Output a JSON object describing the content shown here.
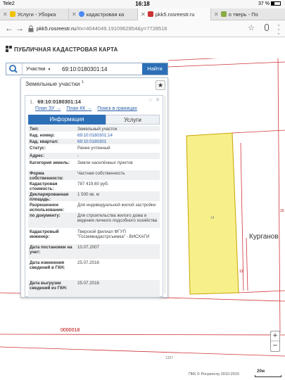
{
  "status_bar": {
    "carrier": "Tele2",
    "time": "16:18",
    "battery": "37 %"
  },
  "browser": {
    "tabs": [
      {
        "title": "Услуги - Уборка",
        "active": false
      },
      {
        "title": "кадастровая ка",
        "active": false
      },
      {
        "title": "pkk5.rosreestr.ru",
        "active": true
      },
      {
        "title": "о тверь - По",
        "active": false
      }
    ],
    "url_host": "pkk5.rosreestr.ru",
    "url_rest": "/#x=4044049.1910962854&y=7728516"
  },
  "page": {
    "title": "ПУБЛИЧНАЯ КАДАСТРОВАЯ КАРТА"
  },
  "search": {
    "type_label": "Участки",
    "query": "69:10:0180301:14",
    "button_label": "Найти"
  },
  "panel": {
    "title": "Земельные участки",
    "title_sup": "1",
    "card": {
      "index": "1.",
      "number": "69:10:0180301:14",
      "links": [
        "План ЗУ →",
        "План КК →",
        "Поиск в границах"
      ],
      "tabs": {
        "info": "Информация",
        "services": "Услуги"
      },
      "rows": [
        {
          "k": "Тип:",
          "v": "Земельный участок",
          "link": false
        },
        {
          "k": "Кад. номер:",
          "v": "69:10:0180301:14",
          "link": true
        },
        {
          "k": "Кад. квартал:",
          "v": "69:10:0180301",
          "link": true
        },
        {
          "k": "Статус:",
          "v": "Ранее учтенный",
          "link": false
        },
        {
          "k": "Адрес:",
          "v": "-",
          "link": false
        },
        {
          "k": "Категория земель:",
          "v": "Земли населённых пунктов",
          "link": false
        },
        {
          "k": "Форма собственности:",
          "v": "Частная собственность",
          "link": false
        },
        {
          "k": "Кадастровая стоимость:",
          "v": "787 419,60 руб.",
          "link": false
        },
        {
          "k": "Декларированная площадь:",
          "v": "1 500 кв. м",
          "link": false
        },
        {
          "k": "Разрешенное использование:",
          "v": "Для индивидуальной жилой застройки",
          "link": false
        },
        {
          "k": "по документу:",
          "v": "Для строительства жилого дома и ведения личного подсобного хозяйства",
          "link": false
        },
        {
          "k": "Кадастровый инженер:",
          "v": "Тверской филиал ФГУП \"Госземкадастрсъемка\" - ВИСХАГИ",
          "link": false
        },
        {
          "k": "Дата постановки на учет:",
          "v": "10.07.2007",
          "link": false
        },
        {
          "k": "Дата изменения сведений в ГКН:",
          "v": "25.07.2016",
          "link": false
        },
        {
          "k": "Дата выгрузки сведений из ГКН:",
          "v": "25.07.2016",
          "link": false
        }
      ]
    }
  },
  "map": {
    "street_label": "Курганов",
    "parcel_code": "0000018",
    "parcel_number": "14",
    "small_labels": [
      "15",
      "13",
      "1327"
    ],
    "zoom_in": "+",
    "zoom_out": "−",
    "copyright": "ПКК © Росреестр 2010-2015",
    "scale_label": "20м",
    "parcel_fill": "#f7f08a",
    "boundary_color": "#d0343a"
  }
}
